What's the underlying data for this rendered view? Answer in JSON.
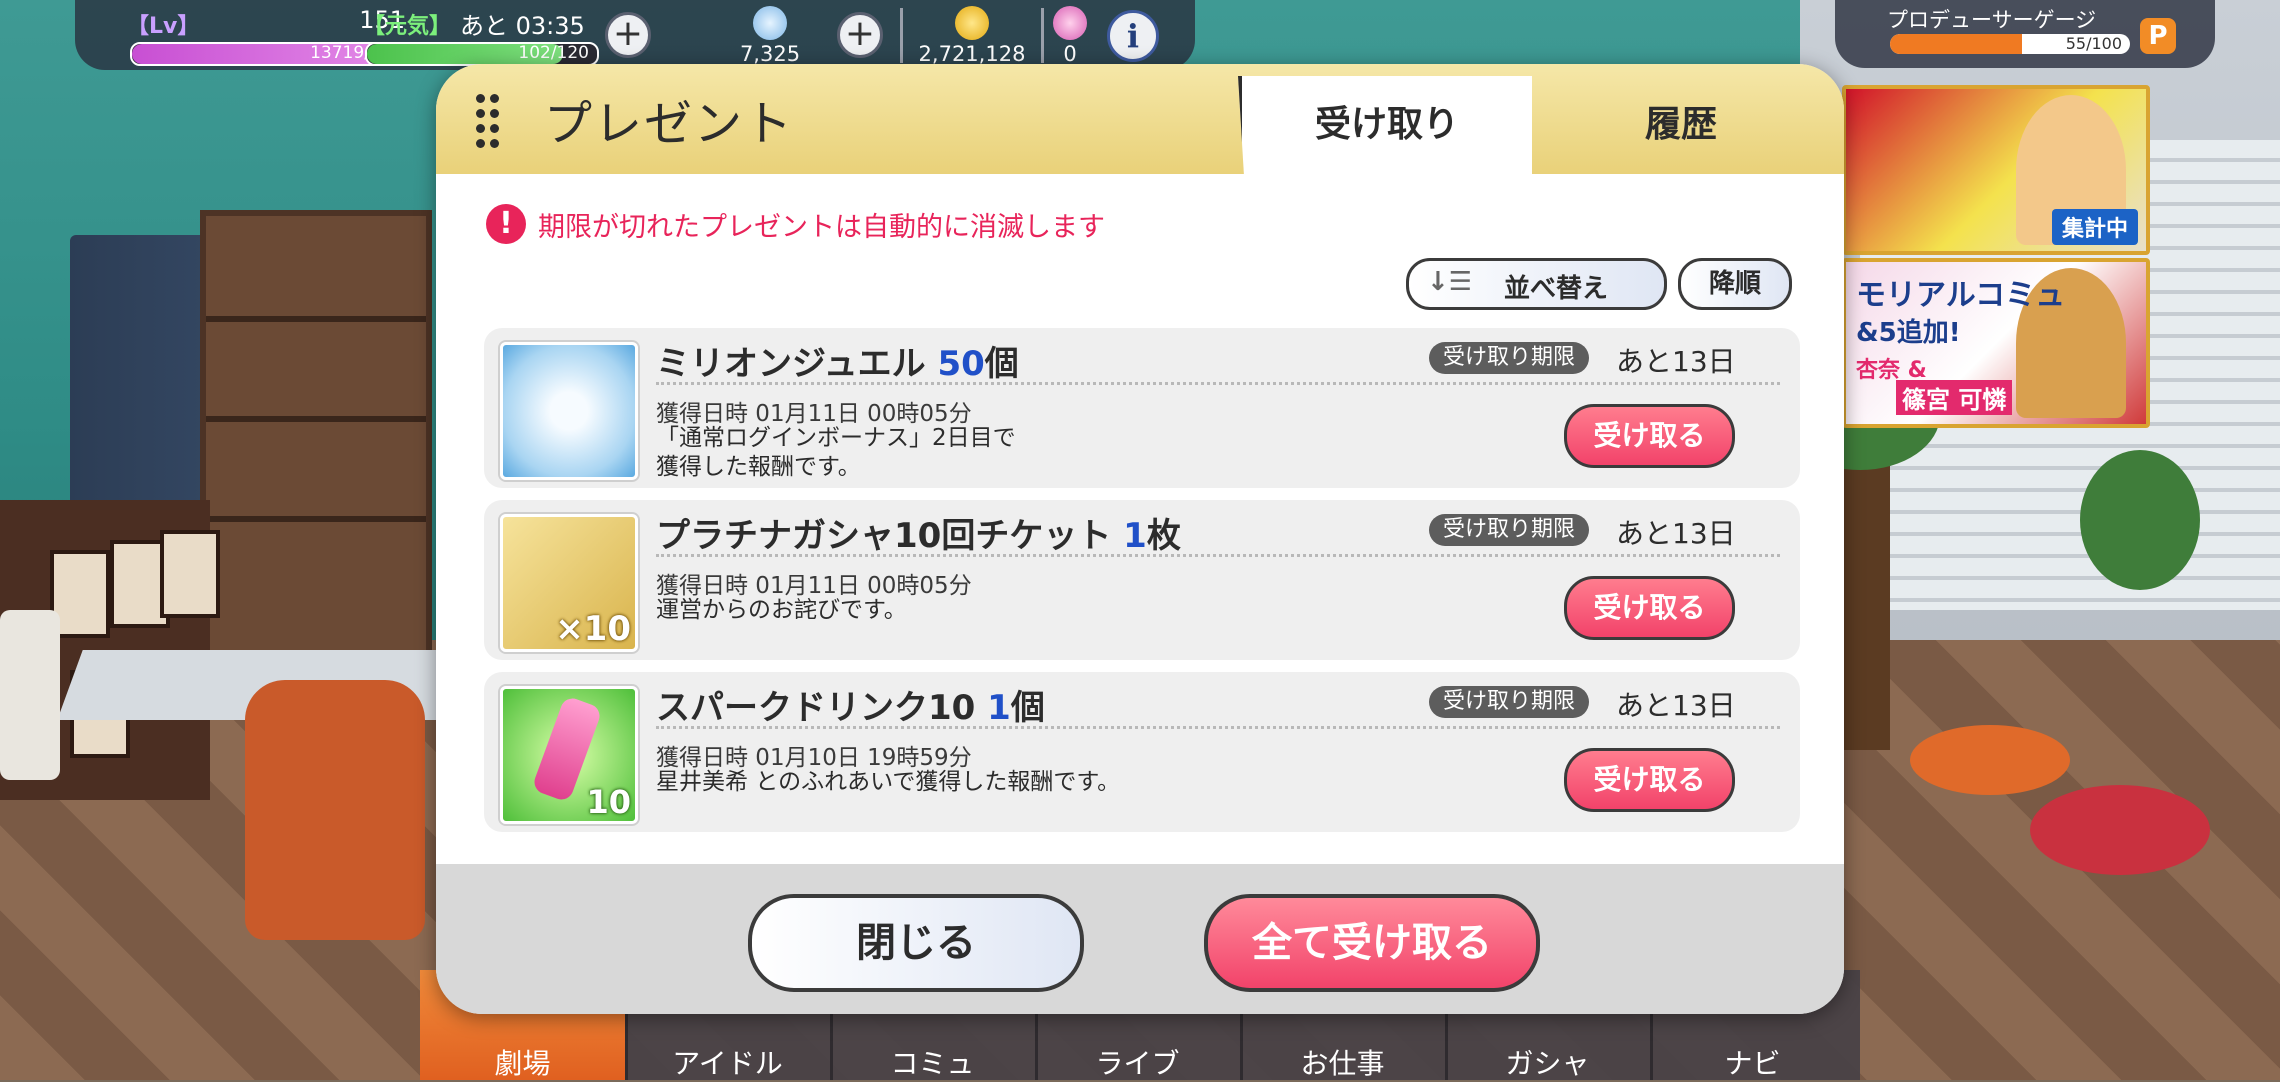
{
  "status": {
    "lv_label": "【Lv】",
    "lv_value": "151",
    "exp": "13719/15050",
    "exp_fraction": 0.91,
    "genki_label": "【元気】",
    "time_remaining": "あと 03:35",
    "stamina": "102/120",
    "stamina_fraction": 0.85,
    "jewels": "7,325",
    "money": "2,721,128",
    "items": "0"
  },
  "producer_gauge": {
    "label": "プロデューサーゲージ",
    "value": "55/100",
    "fraction": 0.55,
    "badge": "P"
  },
  "banners": {
    "banner1": {
      "tag": "集計中"
    },
    "banner2": {
      "line1": "モリアルコミュ",
      "line2": "&5追加!",
      "line3": "杏奈 &",
      "line4": "篠宮 可憐"
    }
  },
  "dialog": {
    "title": "プレゼント",
    "tabs": [
      {
        "label": "受け取り",
        "active": true
      },
      {
        "label": "履歴",
        "active": false
      }
    ],
    "warning": "期限が切れたプレゼントは自動的に消滅します",
    "sort_label": "並べ替え",
    "order_label": "降順",
    "items": [
      {
        "name": "ミリオンジュエル",
        "quantity": "50",
        "unit": "個",
        "limit_badge": "受け取り期限",
        "limit_value": "あと13日",
        "date": "獲得日時 01月11日 00時05分",
        "desc1": "「通常ログインボーナス」2日目で",
        "desc2": "獲得した報酬です。",
        "receive": "受け取る",
        "thumb_label": ""
      },
      {
        "name": "プラチナガシャ10回チケット",
        "quantity": "1",
        "unit": "枚",
        "limit_badge": "受け取り期限",
        "limit_value": "あと13日",
        "date": "獲得日時 01月11日 00時05分",
        "desc1": "運営からのお詫びです。",
        "desc2": "",
        "receive": "受け取る",
        "thumb_label": "×10"
      },
      {
        "name": "スパークドリンク10",
        "quantity": "1",
        "unit": "個",
        "limit_badge": "受け取り期限",
        "limit_value": "あと13日",
        "date": "獲得日時 01月10日 19時59分",
        "desc1": "星井美希 とのふれあいで獲得した報酬です。",
        "desc2": "",
        "receive": "受け取る",
        "thumb_label": "10"
      }
    ],
    "close_label": "閉じる",
    "receive_all_label": "全て受け取る"
  },
  "nav": [
    "劇場",
    "アイドル",
    "コミュ",
    "ライブ",
    "お仕事",
    "ガシャ",
    "ナビ"
  ],
  "colors": {
    "accent_pink": "#f2436a",
    "warning": "#e8245a",
    "quantity_blue": "#2050c8",
    "header_gold": "#e9d179"
  }
}
